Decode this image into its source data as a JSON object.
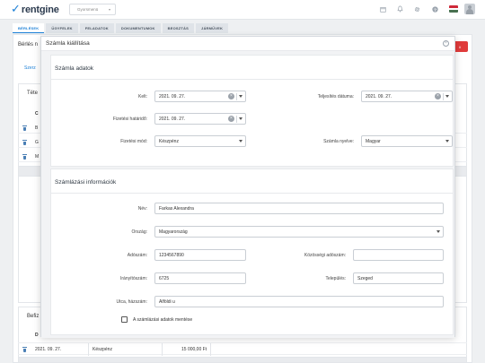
{
  "app": {
    "logo_text": "rentgine",
    "workspace_selector": "Gyorsmenü",
    "flag_colors": [
      "#ce2939",
      "#ffffff",
      "#477050"
    ]
  },
  "tabs": [
    {
      "label": "BÉRLÉSEK",
      "active": true
    },
    {
      "label": "ÜGYFELEK",
      "active": false
    },
    {
      "label": "FELADATOK",
      "active": false
    },
    {
      "label": "DOKUMENTUMOK",
      "active": false
    },
    {
      "label": "BEOSZTÁS",
      "active": false
    },
    {
      "label": "JÁRMŰVEK",
      "active": false
    }
  ],
  "background": {
    "title_fragment": "Bérlés n",
    "link_fragment": "Szerz",
    "section_fragment": "Téte",
    "column_fragment": "C",
    "rows": [
      "B",
      "G",
      "M"
    ],
    "payments_fragment": "Befiz",
    "payments_header_fragment": "D",
    "payment_row": {
      "date": "2021. 09. 27.",
      "method": "Készpénz",
      "amount": "15 000,00 Ft"
    }
  },
  "modal": {
    "title": "Számla kiállítása",
    "close_icon": "close-circle-icon",
    "invoice_section": {
      "title": "Számla adatok",
      "kelt_label": "Kelt:",
      "kelt_value": "2021. 09. 27.",
      "teljesites_label": "Teljesítés dátuma:",
      "teljesites_value": "2021. 09. 27.",
      "fizetesi_hatarido_label": "Fizetési határidő:",
      "fizetesi_hatarido_value": "2021. 09. 27.",
      "fizetesi_mod_label": "Fizetési mód:",
      "fizetesi_mod_value": "Készpénz",
      "szamla_nyelve_label": "Számla nyelve:",
      "szamla_nyelve_value": "Magyar"
    },
    "billing_section": {
      "title": "Számlázási információk",
      "nev_label": "Név:",
      "nev_value": "Farkas Alexandra",
      "orszag_label": "Ország:",
      "orszag_value": "Magyarország",
      "adoszam_label": "Adószám:",
      "adoszam_value": "1234567890",
      "kozossegi_label": "Közösségi adószám:",
      "kozossegi_value": "",
      "iranyitoszam_label": "Irányítószám:",
      "iranyitoszam_value": "6725",
      "telepules_label": "Település:",
      "telepules_value": "Szeged",
      "utca_label": "Utca, házszám:",
      "utca_value": "Alföldi u",
      "save_checkbox_label": "A számlázási adatok mentése"
    }
  }
}
